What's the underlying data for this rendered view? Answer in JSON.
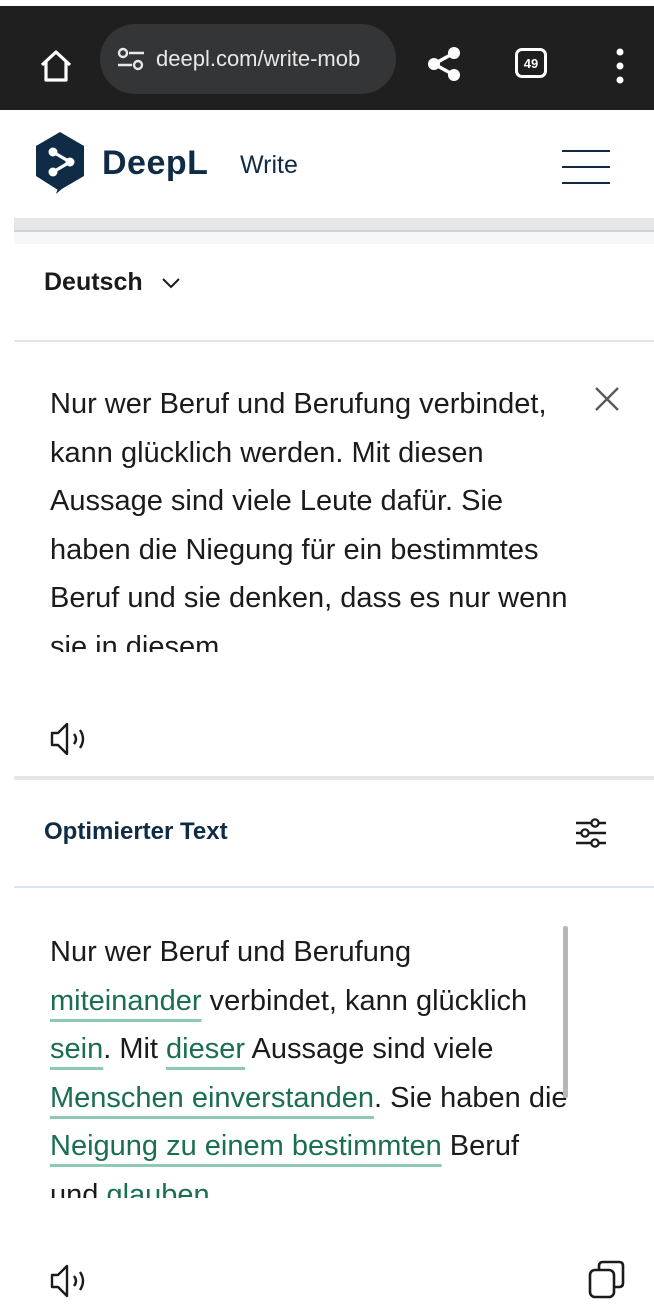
{
  "browser": {
    "url": "deepl.com/write-mob",
    "tab_count": "49",
    "icons": [
      "home-icon",
      "site-settings-icon",
      "share-icon",
      "tabs-icon",
      "more-vert-icon"
    ]
  },
  "app": {
    "brand": "DeepL",
    "product": "Write",
    "icons": [
      "deepl-logo-icon",
      "hamburger-icon"
    ]
  },
  "source": {
    "language": "Deutsch",
    "text": "Nur wer Beruf und Berufung verbindet, kann glücklich werden. Mit diesen Aussage sind viele Leute dafür. Sie haben die Niegung für ein bestimmtes Beruf und sie denken, dass es nur wenn sie in diesem",
    "icons": [
      "chevron-down-icon",
      "close-icon",
      "speaker-icon"
    ]
  },
  "output": {
    "title": "Optimierter Text",
    "segments": [
      {
        "text": "Nur wer Beruf und Berufung ",
        "changed": false
      },
      {
        "text": "miteinander",
        "changed": true
      },
      {
        "text": " verbindet, kann glücklich ",
        "changed": false
      },
      {
        "text": "sein",
        "changed": true
      },
      {
        "text": ". Mit ",
        "changed": false
      },
      {
        "text": "dieser",
        "changed": true
      },
      {
        "text": " Aussage sind viele ",
        "changed": false
      },
      {
        "text": "Menschen einverstanden",
        "changed": true
      },
      {
        "text": ". Sie haben die ",
        "changed": false
      },
      {
        "text": "Neigung zu einem bestimmten",
        "changed": true
      },
      {
        "text": " Beruf und ",
        "changed": false
      },
      {
        "text": "glauben",
        "changed": true
      },
      {
        "text": ",",
        "changed": false
      }
    ],
    "icons": [
      "tune-icon",
      "speaker-icon",
      "copy-icon"
    ]
  },
  "colors": {
    "brand_navy": "#0f2b46",
    "change_text": "#1a6e52",
    "change_underline": "#8fc8b7",
    "chrome_bg": "#1f1f1f"
  }
}
